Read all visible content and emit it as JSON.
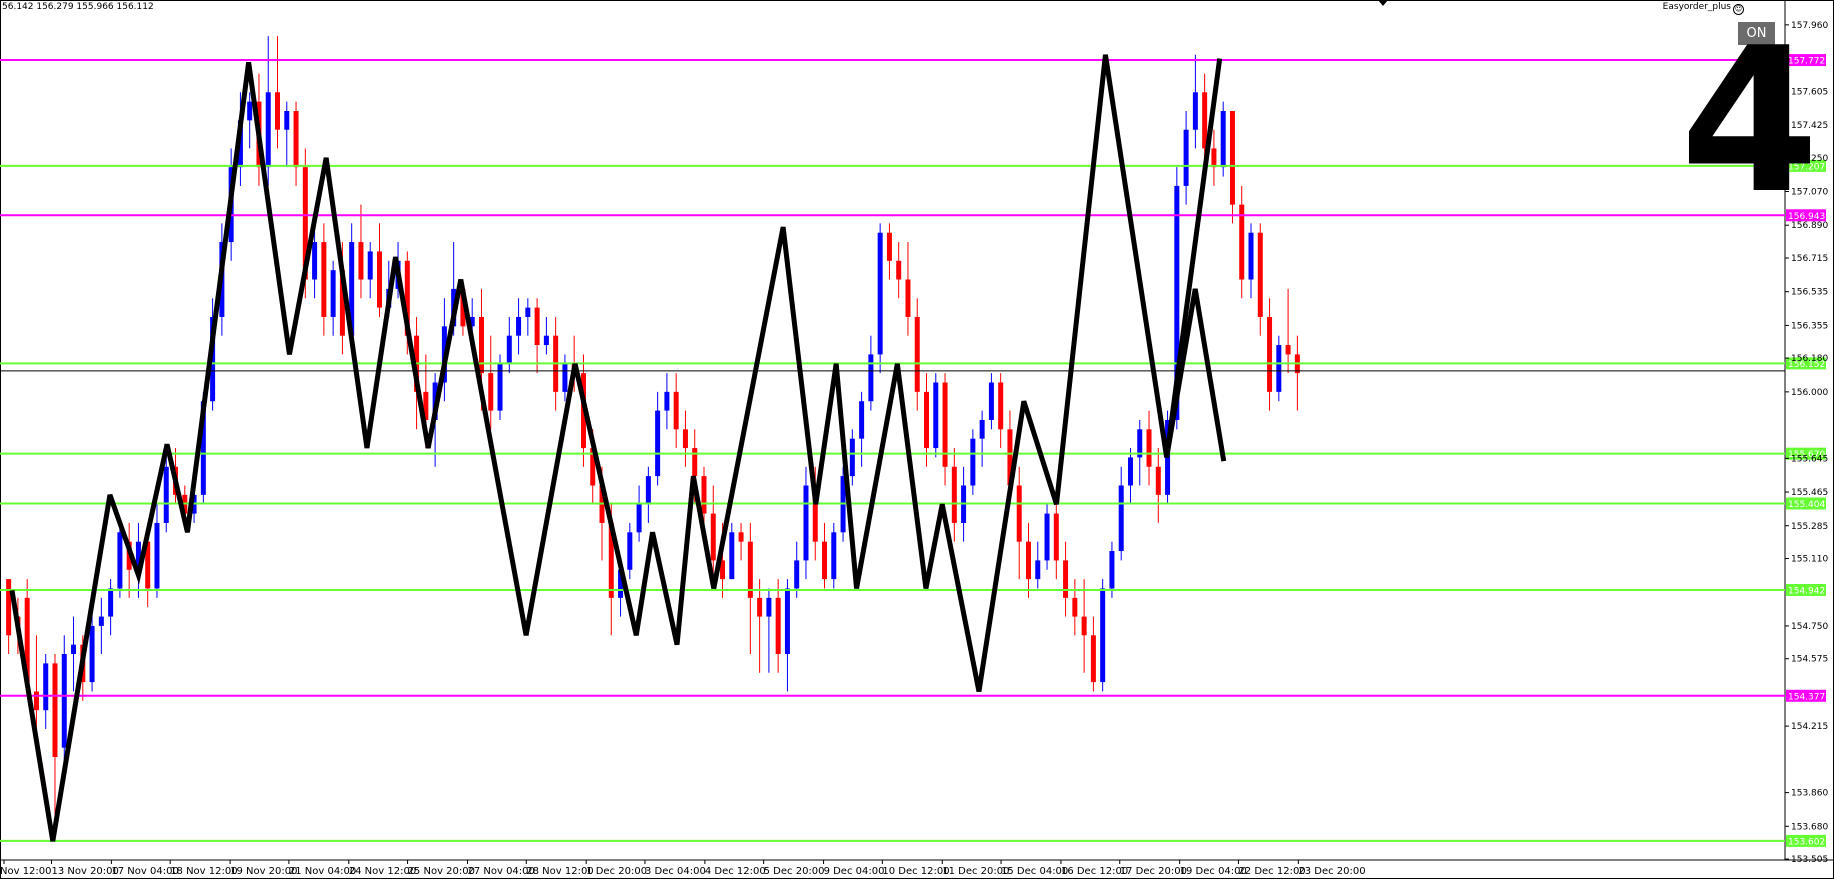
{
  "header": {
    "ohlc": "56.142 156.279 155.966 156.112",
    "ea_name": "Easyorder_plus",
    "on_button": "ON"
  },
  "overlay": {
    "big_number": "4"
  },
  "colors": {
    "bull": "#0000ff",
    "bear": "#ff0000",
    "magenta": "#ff00ff",
    "green": "#66ff33",
    "zigzag": "#000000",
    "bid": "#000000"
  },
  "chart_data": {
    "type": "candlestick",
    "ylim": [
      153.5,
      158.05
    ],
    "price_ticks": [
      "157.960",
      "157.605",
      "157.425",
      "157.250",
      "157.070",
      "156.890",
      "156.715",
      "156.535",
      "156.355",
      "156.180",
      "156.000",
      "155.645",
      "155.465",
      "155.285",
      "155.110",
      "154.750",
      "154.575",
      "154.215",
      "153.860",
      "153.680",
      "153.505"
    ],
    "time_labels": [
      "Nov 12:00",
      "13 Nov 20:00",
      "17 Nov 04:00",
      "18 Nov 12:00",
      "19 Nov 20:00",
      "21 Nov 04:00",
      "24 Nov 12:00",
      "25 Nov 20:00",
      "27 Nov 04:00",
      "28 Nov 12:00",
      "1 Dec 20:00",
      "3 Dec 04:00",
      "4 Dec 12:00",
      "5 Dec 20:00",
      "9 Dec 04:00",
      "10 Dec 12:00",
      "11 Dec 20:00",
      "15 Dec 04:00",
      "16 Dec 12:00",
      "17 Dec 20:00",
      "19 Dec 04:00",
      "22 Dec 12:00",
      "23 Dec 20:00"
    ],
    "time_label_positions": [
      0,
      42,
      95,
      147,
      200,
      252,
      305,
      357,
      410,
      462,
      515,
      567,
      620,
      672,
      725,
      777,
      830,
      882,
      935,
      987,
      1040,
      1092,
      1145
    ],
    "levels": [
      {
        "price": 157.772,
        "label": "157.772",
        "color": "magenta"
      },
      {
        "price": 157.207,
        "label": "157.207",
        "color": "green"
      },
      {
        "price": 156.943,
        "label": "156.943",
        "color": "magenta"
      },
      {
        "price": 156.152,
        "label": "156.152",
        "color": "green"
      },
      {
        "price": 155.67,
        "label": "155.670",
        "color": "green"
      },
      {
        "price": 155.404,
        "label": "155.404",
        "color": "green"
      },
      {
        "price": 154.942,
        "label": "154.942",
        "color": "green"
      },
      {
        "price": 154.377,
        "label": "154.377",
        "color": "magenta"
      },
      {
        "price": 153.602,
        "label": "153.602",
        "color": "green"
      }
    ],
    "bid_price": 156.112,
    "bid_label": "156.112",
    "zigzag": [
      [
        0,
        154.94
      ],
      [
        10,
        153.6
      ],
      [
        24,
        155.45
      ],
      [
        31,
        155.02
      ],
      [
        38,
        155.72
      ],
      [
        43,
        155.25
      ],
      [
        58,
        157.76
      ],
      [
        68,
        156.2
      ],
      [
        77,
        157.25
      ],
      [
        87,
        155.7
      ],
      [
        94,
        156.72
      ],
      [
        102,
        155.7
      ],
      [
        110,
        156.6
      ],
      [
        126,
        154.7
      ],
      [
        138,
        156.15
      ],
      [
        153,
        154.7
      ],
      [
        157,
        155.25
      ],
      [
        163,
        154.65
      ],
      [
        167,
        155.55
      ],
      [
        172,
        154.95
      ],
      [
        189,
        156.88
      ],
      [
        197,
        155.4
      ],
      [
        202,
        156.15
      ],
      [
        207,
        154.95
      ],
      [
        217,
        156.15
      ],
      [
        224,
        154.95
      ],
      [
        228,
        155.4
      ],
      [
        237,
        154.4
      ],
      [
        248,
        155.95
      ],
      [
        256,
        155.4
      ],
      [
        268,
        157.8
      ],
      [
        283,
        155.65
      ],
      [
        290,
        156.55
      ],
      [
        297,
        155.63
      ],
      [
        1000,
        155.63
      ]
    ],
    "zigzag_extra": [
      [
        283,
        155.65
      ],
      [
        296,
        157.78
      ]
    ],
    "candles": [
      [
        155.0,
        154.9,
        154.7,
        154.6
      ],
      [
        154.8,
        154.9,
        154.75,
        154.6
      ],
      [
        154.9,
        155.0,
        154.45,
        154.4
      ],
      [
        154.4,
        154.7,
        154.3,
        154.2
      ],
      [
        154.3,
        154.6,
        154.55,
        154.2
      ],
      [
        154.55,
        154.6,
        154.05,
        153.6
      ],
      [
        154.1,
        154.7,
        154.6,
        154.0
      ],
      [
        154.6,
        154.8,
        154.65,
        154.4
      ],
      [
        154.65,
        154.7,
        154.45,
        154.35
      ],
      [
        154.45,
        154.8,
        154.75,
        154.4
      ],
      [
        154.75,
        154.9,
        154.8,
        154.6
      ],
      [
        154.8,
        155.0,
        154.95,
        154.7
      ],
      [
        154.95,
        155.3,
        155.25,
        154.9
      ],
      [
        155.2,
        155.3,
        155.05,
        154.9
      ],
      [
        155.05,
        155.3,
        155.2,
        154.9
      ],
      [
        155.2,
        155.3,
        154.95,
        154.85
      ],
      [
        154.95,
        155.4,
        155.3,
        154.9
      ],
      [
        155.3,
        155.7,
        155.6,
        155.25
      ],
      [
        155.6,
        155.7,
        155.45,
        155.4
      ],
      [
        155.45,
        155.5,
        155.35,
        155.3
      ],
      [
        155.35,
        155.5,
        155.45,
        155.3
      ],
      [
        155.45,
        156.0,
        155.95,
        155.4
      ],
      [
        155.95,
        156.5,
        156.4,
        155.9
      ],
      [
        156.4,
        156.9,
        156.8,
        156.3
      ],
      [
        156.8,
        157.3,
        157.2,
        156.7
      ],
      [
        157.2,
        157.6,
        157.45,
        157.1
      ],
      [
        157.45,
        157.6,
        157.55,
        157.3
      ],
      [
        157.55,
        157.7,
        157.2,
        157.1
      ],
      [
        157.2,
        157.9,
        157.6,
        157.1
      ],
      [
        157.6,
        157.9,
        157.4,
        157.3
      ],
      [
        157.4,
        157.55,
        157.5,
        157.2
      ],
      [
        157.5,
        157.55,
        157.2,
        157.1
      ],
      [
        157.2,
        157.3,
        156.6,
        156.5
      ],
      [
        156.6,
        156.9,
        156.8,
        156.5
      ],
      [
        156.8,
        156.9,
        156.4,
        156.3
      ],
      [
        156.4,
        156.7,
        156.65,
        156.3
      ],
      [
        156.65,
        156.8,
        156.3,
        156.2
      ],
      [
        156.3,
        156.9,
        156.8,
        156.25
      ],
      [
        156.8,
        157.0,
        156.6,
        156.5
      ],
      [
        156.6,
        156.8,
        156.75,
        156.5
      ],
      [
        156.75,
        156.9,
        156.45,
        156.4
      ],
      [
        156.45,
        156.7,
        156.55,
        156.4
      ],
      [
        156.55,
        156.8,
        156.7,
        156.5
      ],
      [
        156.7,
        156.75,
        156.3,
        156.2
      ],
      [
        156.3,
        156.4,
        156.0,
        155.8
      ],
      [
        156.0,
        156.2,
        155.85,
        155.7
      ],
      [
        155.85,
        156.1,
        156.05,
        155.6
      ],
      [
        156.05,
        156.5,
        156.35,
        155.95
      ],
      [
        156.35,
        156.8,
        156.55,
        156.3
      ],
      [
        156.55,
        156.6,
        156.35,
        156.3
      ],
      [
        156.35,
        156.5,
        156.4,
        156.3
      ],
      [
        156.4,
        156.55,
        156.1,
        155.9
      ],
      [
        156.1,
        156.3,
        155.9,
        155.8
      ],
      [
        155.9,
        156.2,
        156.15,
        155.85
      ],
      [
        156.15,
        156.4,
        156.3,
        156.1
      ],
      [
        156.3,
        156.5,
        156.4,
        156.2
      ],
      [
        156.4,
        156.5,
        156.45,
        156.3
      ],
      [
        156.45,
        156.5,
        156.25,
        156.1
      ],
      [
        156.25,
        156.4,
        156.3,
        156.2
      ],
      [
        156.3,
        156.4,
        156.0,
        155.9
      ],
      [
        156.0,
        156.2,
        156.15,
        155.95
      ],
      [
        156.15,
        156.3,
        156.1,
        156.0
      ],
      [
        156.1,
        156.2,
        155.7,
        155.6
      ],
      [
        155.7,
        155.8,
        155.5,
        155.4
      ],
      [
        155.5,
        155.6,
        155.3,
        155.1
      ],
      [
        155.3,
        155.4,
        154.9,
        154.7
      ],
      [
        154.9,
        155.1,
        155.05,
        154.8
      ],
      [
        155.05,
        155.3,
        155.25,
        155.0
      ],
      [
        155.25,
        155.5,
        155.4,
        155.2
      ],
      [
        155.4,
        155.6,
        155.55,
        155.3
      ],
      [
        155.55,
        156.0,
        155.9,
        155.5
      ],
      [
        155.9,
        156.1,
        156.0,
        155.8
      ],
      [
        156.0,
        156.1,
        155.8,
        155.7
      ],
      [
        155.8,
        155.9,
        155.7,
        155.6
      ],
      [
        155.7,
        155.8,
        155.55,
        155.4
      ],
      [
        155.55,
        155.6,
        155.35,
        155.3
      ],
      [
        155.35,
        155.5,
        155.1,
        155.0
      ],
      [
        155.1,
        155.3,
        155.0,
        154.9
      ],
      [
        155.0,
        155.3,
        155.25,
        155.0
      ],
      [
        155.25,
        155.3,
        155.2,
        155.1
      ],
      [
        155.2,
        155.3,
        154.9,
        154.6
      ],
      [
        154.9,
        155.0,
        154.8,
        154.5
      ],
      [
        154.8,
        154.95,
        154.9,
        154.5
      ],
      [
        154.9,
        155.0,
        154.6,
        154.5
      ],
      [
        154.6,
        155.0,
        154.95,
        154.4
      ],
      [
        154.95,
        155.2,
        155.1,
        154.9
      ],
      [
        155.1,
        155.6,
        155.5,
        155.0
      ],
      [
        155.5,
        155.6,
        155.2,
        155.1
      ],
      [
        155.2,
        155.3,
        155.0,
        154.95
      ],
      [
        155.0,
        155.3,
        155.25,
        154.95
      ],
      [
        155.25,
        155.6,
        155.55,
        155.2
      ],
      [
        155.55,
        155.8,
        155.75,
        155.5
      ],
      [
        155.75,
        156.0,
        155.95,
        155.6
      ],
      [
        155.95,
        156.3,
        156.2,
        155.9
      ],
      [
        156.2,
        156.9,
        156.85,
        156.1
      ],
      [
        156.85,
        156.9,
        156.7,
        156.6
      ],
      [
        156.7,
        156.8,
        156.6,
        156.5
      ],
      [
        156.6,
        156.8,
        156.4,
        156.3
      ],
      [
        156.4,
        156.5,
        156.0,
        155.9
      ],
      [
        156.0,
        156.1,
        155.7,
        155.6
      ],
      [
        155.7,
        156.1,
        156.05,
        155.65
      ],
      [
        156.05,
        156.1,
        155.6,
        155.5
      ],
      [
        155.6,
        155.7,
        155.3,
        155.2
      ],
      [
        155.3,
        155.6,
        155.5,
        155.2
      ],
      [
        155.5,
        155.8,
        155.75,
        155.45
      ],
      [
        155.75,
        155.9,
        155.85,
        155.6
      ],
      [
        155.85,
        156.1,
        156.05,
        155.8
      ],
      [
        156.05,
        156.1,
        155.8,
        155.7
      ],
      [
        155.8,
        155.9,
        155.5,
        155.4
      ],
      [
        155.5,
        155.6,
        155.2,
        155.0
      ],
      [
        155.2,
        155.3,
        155.0,
        154.9
      ],
      [
        155.0,
        155.2,
        155.1,
        154.95
      ],
      [
        155.1,
        155.4,
        155.35,
        155.05
      ],
      [
        155.35,
        155.4,
        155.1,
        155.0
      ],
      [
        155.1,
        155.2,
        154.9,
        154.8
      ],
      [
        154.9,
        155.0,
        154.8,
        154.7
      ],
      [
        154.8,
        155.0,
        154.7,
        154.5
      ],
      [
        154.7,
        154.8,
        154.45,
        154.4
      ],
      [
        154.45,
        155.0,
        154.95,
        154.4
      ],
      [
        154.95,
        155.2,
        155.15,
        154.9
      ],
      [
        155.15,
        155.6,
        155.5,
        155.1
      ],
      [
        155.5,
        155.7,
        155.65,
        155.4
      ],
      [
        155.65,
        155.85,
        155.8,
        155.5
      ],
      [
        155.8,
        155.9,
        155.6,
        155.5
      ],
      [
        155.6,
        155.7,
        155.45,
        155.3
      ],
      [
        155.45,
        155.9,
        155.85,
        155.4
      ],
      [
        155.85,
        157.2,
        157.1,
        155.8
      ],
      [
        157.1,
        157.5,
        157.4,
        157.0
      ],
      [
        157.4,
        157.8,
        157.6,
        157.3
      ],
      [
        157.6,
        157.7,
        157.3,
        157.2
      ],
      [
        157.3,
        157.4,
        157.2,
        157.1
      ],
      [
        157.2,
        157.55,
        157.5,
        157.15
      ],
      [
        157.5,
        157.5,
        157.0,
        156.9
      ],
      [
        157.0,
        157.1,
        156.6,
        156.5
      ],
      [
        156.6,
        156.9,
        156.85,
        156.5
      ],
      [
        156.85,
        156.9,
        156.4,
        156.3
      ],
      [
        156.4,
        156.5,
        156.0,
        155.9
      ],
      [
        156.0,
        156.3,
        156.25,
        155.95
      ],
      [
        156.25,
        156.55,
        156.2,
        156.1
      ],
      [
        156.2,
        156.3,
        156.1,
        155.9
      ]
    ]
  }
}
